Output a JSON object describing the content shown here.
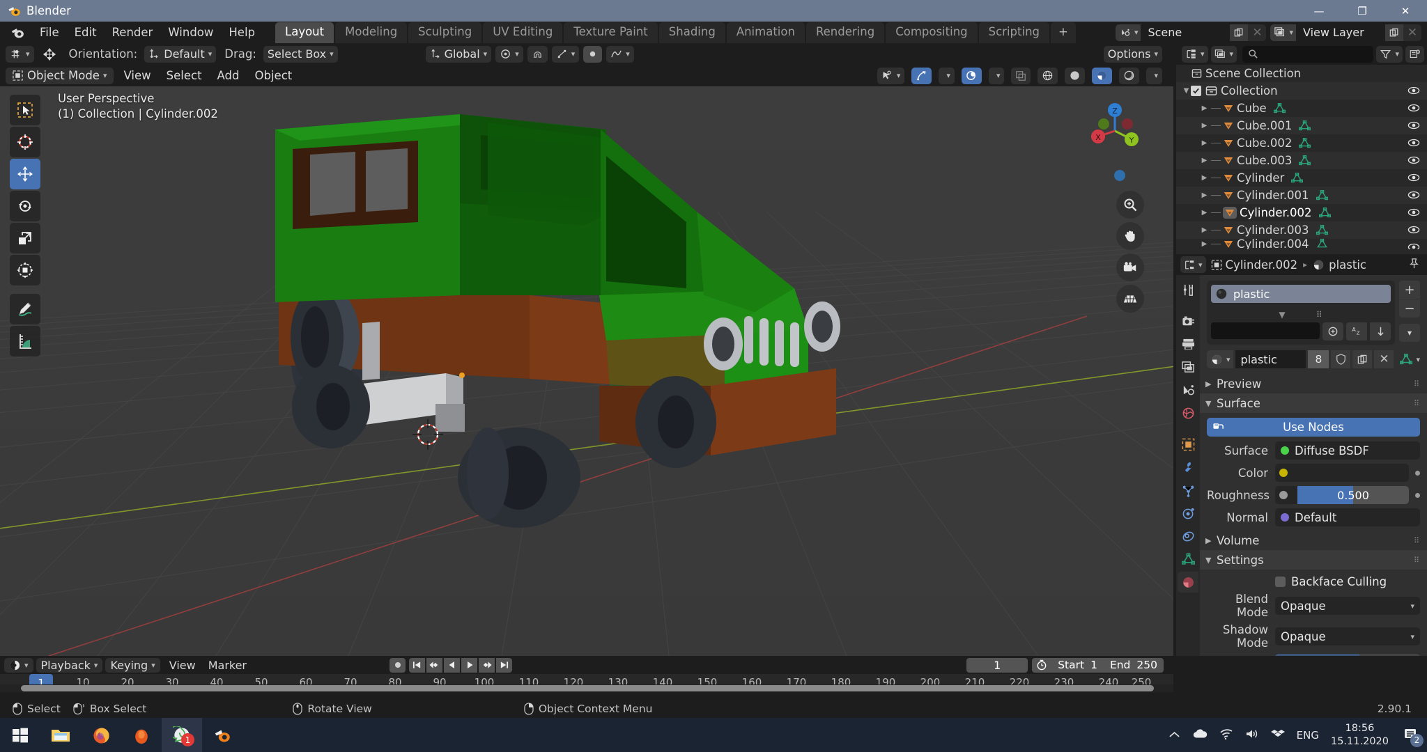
{
  "window": {
    "title": "Blender",
    "controls": {
      "minimize": "—",
      "maximize": "❐",
      "close": "✕"
    }
  },
  "topbar": {
    "menus": [
      "File",
      "Edit",
      "Render",
      "Window",
      "Help"
    ],
    "workspaces": [
      {
        "label": "Layout",
        "active": true
      },
      {
        "label": "Modeling",
        "active": false
      },
      {
        "label": "Sculpting",
        "active": false
      },
      {
        "label": "UV Editing",
        "active": false
      },
      {
        "label": "Texture Paint",
        "active": false
      },
      {
        "label": "Shading",
        "active": false
      },
      {
        "label": "Animation",
        "active": false
      },
      {
        "label": "Rendering",
        "active": false
      },
      {
        "label": "Compositing",
        "active": false
      },
      {
        "label": "Scripting",
        "active": false
      }
    ],
    "add_workspace": "+",
    "scene": {
      "name": "Scene",
      "icon": "scene-icon"
    },
    "view_layer": {
      "name": "View Layer",
      "icon": "view-layer-icon"
    }
  },
  "tool_settings": {
    "orientation_label": "Orientation:",
    "orientation_value": "Default",
    "drag_label": "Drag:",
    "drag_value": "Select Box",
    "transform_value": "Global",
    "options_label": "Options"
  },
  "viewport_header": {
    "mode": "Object Mode",
    "menus": [
      "View",
      "Select",
      "Add",
      "Object"
    ]
  },
  "viewport": {
    "perspective": "User Perspective",
    "breadcrumb": "(1) Collection | Cylinder.002",
    "gizmo_axes": {
      "x": "X",
      "y": "Y",
      "z": "Z"
    },
    "tools": [
      {
        "name": "tweak-tool",
        "active": false
      },
      {
        "name": "cursor-tool",
        "active": false
      },
      {
        "name": "move-tool",
        "active": true
      },
      {
        "name": "rotate-tool",
        "active": false
      },
      {
        "name": "scale-tool",
        "active": false
      },
      {
        "name": "transform-tool",
        "active": false
      },
      {
        "name": "annotate-tool",
        "active": false
      },
      {
        "name": "measure-tool",
        "active": false
      }
    ],
    "nav_buttons": [
      "zoom-icon",
      "pan-hand-icon",
      "camera-view-icon",
      "orthographic-grid-icon"
    ],
    "model_colors": {
      "body_green": "#1e8c14",
      "body_green_dark": "#0f5c0a",
      "cab_shadow": "#0b4a07",
      "chassis_brown": "#6e3414",
      "tire_dark": "#2b2f36",
      "tire_mid": "#535b66",
      "metal_grey": "#b9bcc0",
      "ground": "#3b3b3b",
      "grid_line": "#4a4a4a",
      "axis_x": "#b13b3b",
      "axis_y": "#8faf2f"
    }
  },
  "outliner": {
    "search_placeholder": "",
    "root": "Scene Collection",
    "collection": "Collection",
    "items": [
      {
        "label": "Cube",
        "selected": false
      },
      {
        "label": "Cube.001",
        "selected": false
      },
      {
        "label": "Cube.002",
        "selected": false
      },
      {
        "label": "Cube.003",
        "selected": false
      },
      {
        "label": "Cylinder",
        "selected": false
      },
      {
        "label": "Cylinder.001",
        "selected": false
      },
      {
        "label": "Cylinder.002",
        "selected": true
      },
      {
        "label": "Cylinder.003",
        "selected": false
      },
      {
        "label": "Cylinder.004",
        "selected": false
      }
    ]
  },
  "properties": {
    "breadcrumb_object": "Cylinder.002",
    "breadcrumb_material": "plastic",
    "material_slot": "plastic",
    "material_name": "plastic",
    "material_users": "8",
    "panels": {
      "preview": "Preview",
      "surface": "Surface",
      "volume": "Volume",
      "settings": "Settings"
    },
    "use_nodes": "Use Nodes",
    "surface_label": "Surface",
    "surface_value": "Diffuse BSDF",
    "color_label": "Color",
    "color_value": "#c8b400",
    "roughness_label": "Roughness",
    "roughness_value": "0.500",
    "roughness_fraction": 0.5,
    "normal_label": "Normal",
    "normal_value": "Default",
    "backface_culling": "Backface Culling",
    "blend_mode_label": "Blend Mode",
    "blend_mode_value": "Opaque",
    "shadow_mode_label": "Shadow Mode",
    "shadow_mode_value": "Opaque",
    "tabs": [
      {
        "name": "tool-tab",
        "active": false
      },
      {
        "name": "render-tab",
        "active": false
      },
      {
        "name": "output-tab",
        "active": false
      },
      {
        "name": "view-layer-tab",
        "active": false
      },
      {
        "name": "scene-tab",
        "active": false
      },
      {
        "name": "world-tab",
        "active": false
      },
      {
        "name": "object-tab",
        "active": false
      },
      {
        "name": "modifier-tab",
        "active": false
      },
      {
        "name": "particles-tab",
        "active": false
      },
      {
        "name": "physics-tab",
        "active": false
      },
      {
        "name": "constraints-tab",
        "active": false
      },
      {
        "name": "object-data-tab",
        "active": false
      },
      {
        "name": "material-tab",
        "active": true
      }
    ]
  },
  "timeline": {
    "menus": [
      "View",
      "Marker"
    ],
    "playback": "Playback",
    "keying": "Keying",
    "current_frame": "1",
    "start_label": "Start",
    "start_value": "1",
    "end_label": "End",
    "end_value": "250",
    "ticks": [
      "1",
      "10",
      "20",
      "30",
      "40",
      "50",
      "60",
      "70",
      "80",
      "90",
      "100",
      "110",
      "120",
      "130",
      "140",
      "150",
      "160",
      "170",
      "180",
      "190",
      "200",
      "210",
      "220",
      "230",
      "240",
      "250"
    ],
    "playhead_frame": "1"
  },
  "statusbar": {
    "items": [
      {
        "icon": "mouse-left-icon",
        "label": "Select"
      },
      {
        "icon": "mouse-drag-icon",
        "label": "Box Select"
      },
      {
        "icon": "mouse-middle-icon",
        "label": "Rotate View"
      },
      {
        "icon": "mouse-right-icon",
        "label": "Object Context Menu"
      }
    ],
    "version": "2.90.1"
  },
  "taskbar": {
    "items": [
      {
        "name": "start-button",
        "icon": "windows-icon"
      },
      {
        "name": "file-explorer",
        "icon": "folder-icon"
      },
      {
        "name": "firefox",
        "icon": "firefox-icon"
      },
      {
        "name": "browser-app",
        "icon": "orange-circle-icon"
      },
      {
        "name": "whatsapp",
        "icon": "whatsapp-icon",
        "badge": "1",
        "active": true
      },
      {
        "name": "blender-taskbar",
        "icon": "blender-icon"
      }
    ],
    "tray": {
      "language": "ENG",
      "time": "18:56",
      "date": "15.11.2020",
      "notification_count": "2"
    }
  }
}
